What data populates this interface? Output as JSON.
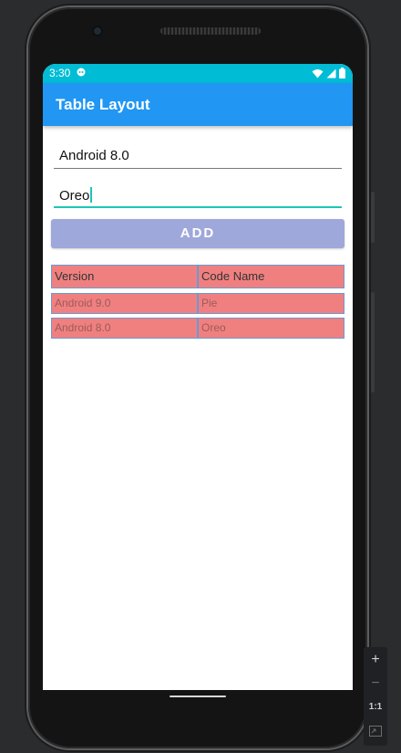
{
  "status_bar": {
    "time": "3:30",
    "notification_icon": "assistant-icon",
    "icons": [
      "wifi-icon",
      "signal-icon",
      "battery-icon"
    ]
  },
  "app_bar": {
    "title": "Table Layout",
    "color": "#2196f3"
  },
  "form": {
    "version_value": "Android 8.0",
    "codename_value": "Oreo",
    "add_label": "ADD"
  },
  "table": {
    "headers": [
      "Version",
      "Code Name"
    ],
    "rows": [
      [
        "Android 9.0",
        "Pie"
      ],
      [
        "Android 8.0",
        "Oreo"
      ]
    ],
    "cell_color": "#f08080",
    "border_color": "#6d98d3"
  },
  "emulator_tools": {
    "zoom_in": "+",
    "zoom_out": "−",
    "ratio": "1:1",
    "fit": "fit-screen-icon"
  }
}
